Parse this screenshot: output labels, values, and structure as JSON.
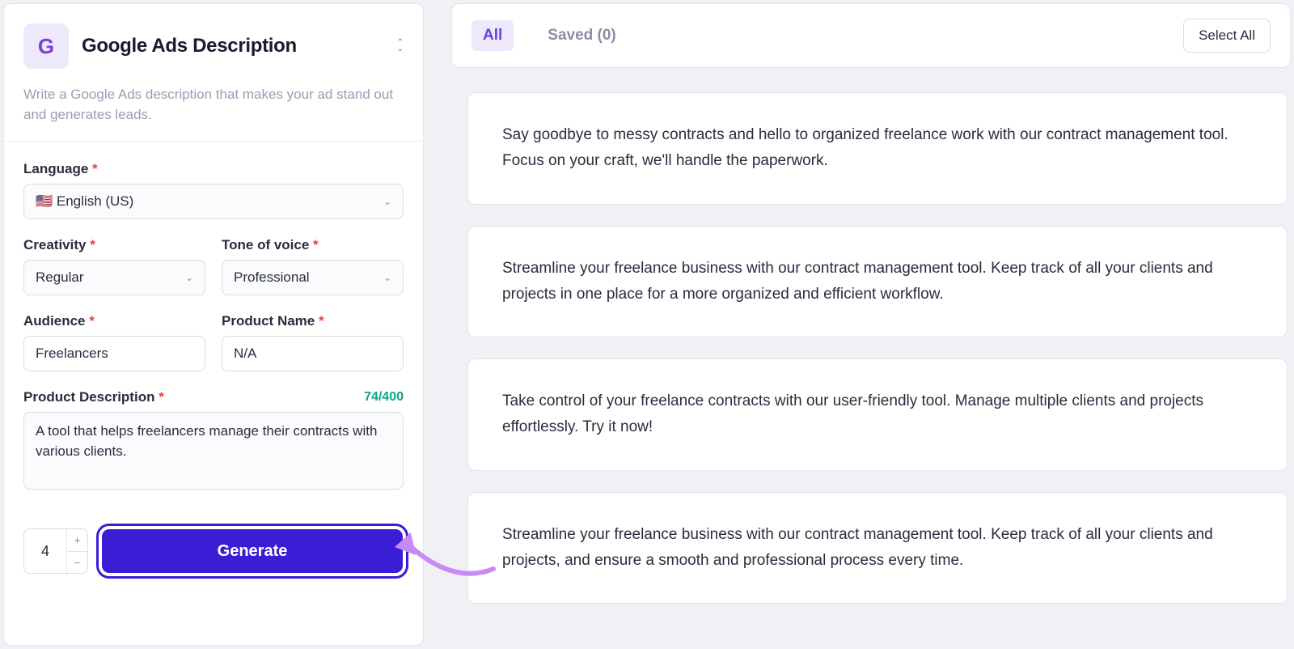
{
  "header": {
    "logo_letter": "G",
    "title": "Google Ads Description",
    "description": "Write a Google Ads description that makes your ad stand out and generates leads."
  },
  "form": {
    "language_label": "Language",
    "language_value": "🇺🇸 English (US)",
    "creativity_label": "Creativity",
    "creativity_value": "Regular",
    "tone_label": "Tone of voice",
    "tone_value": "Professional",
    "audience_label": "Audience",
    "audience_value": "Freelancers",
    "product_name_label": "Product Name",
    "product_name_value": "N/A",
    "product_desc_label": "Product Description",
    "char_count": "74/400",
    "product_desc_value": "A tool that helps freelancers manage their contracts with various clients.",
    "num_value": "4",
    "generate_label": "Generate"
  },
  "tabs": {
    "all": "All",
    "saved": "Saved (0)",
    "select_all": "Select All"
  },
  "results": [
    "Say goodbye to messy contracts and hello to organized freelance work with our contract management tool. Focus on your craft, we'll handle the paperwork.",
    "Streamline your freelance business with our contract management tool. Keep track of all your clients and projects in one place for a more organized and efficient workflow.",
    "Take control of your freelance contracts with our user-friendly tool. Manage multiple clients and projects effortlessly. Try it now!",
    "Streamline your freelance business with our contract management tool. Keep track of all your clients and projects, and ensure a smooth and professional process every time."
  ]
}
